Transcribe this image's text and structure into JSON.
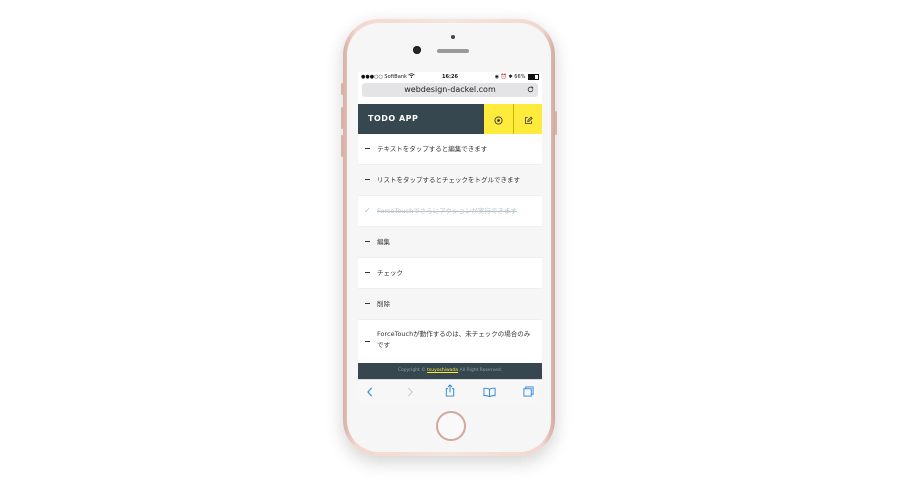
{
  "status_bar": {
    "carrier": "SoftBank",
    "time": "16:26",
    "battery": "66%",
    "battery_level": 0.66
  },
  "browser": {
    "url": "webdesign-dackel.com"
  },
  "app": {
    "title": "TODO APP",
    "accent_color": "#ffeb3b",
    "header_color": "#37474f",
    "buttons": [
      {
        "icon": "circle-plus-icon"
      },
      {
        "icon": "edit-icon"
      }
    ]
  },
  "todos": [
    {
      "text": "テキストをタップすると編集できます",
      "done": false
    },
    {
      "text": "リストをタップするとチェックをトグルできます",
      "done": false
    },
    {
      "text": "ForceTouchでさらにアクションが実行できます",
      "done": true
    },
    {
      "text": "編集",
      "done": false
    },
    {
      "text": "チェック",
      "done": false
    },
    {
      "text": "削除",
      "done": false
    },
    {
      "text": "ForceTouchが動作するのは、未チェックの場合のみです",
      "done": false
    }
  ],
  "footer": {
    "prefix": "Copyright ©",
    "author": "tsuyoshiwada",
    "suffix": "All Right Reserved."
  },
  "toolbar": {
    "icons": [
      "back-icon",
      "forward-icon",
      "share-icon",
      "bookmarks-icon",
      "tabs-icon"
    ]
  }
}
